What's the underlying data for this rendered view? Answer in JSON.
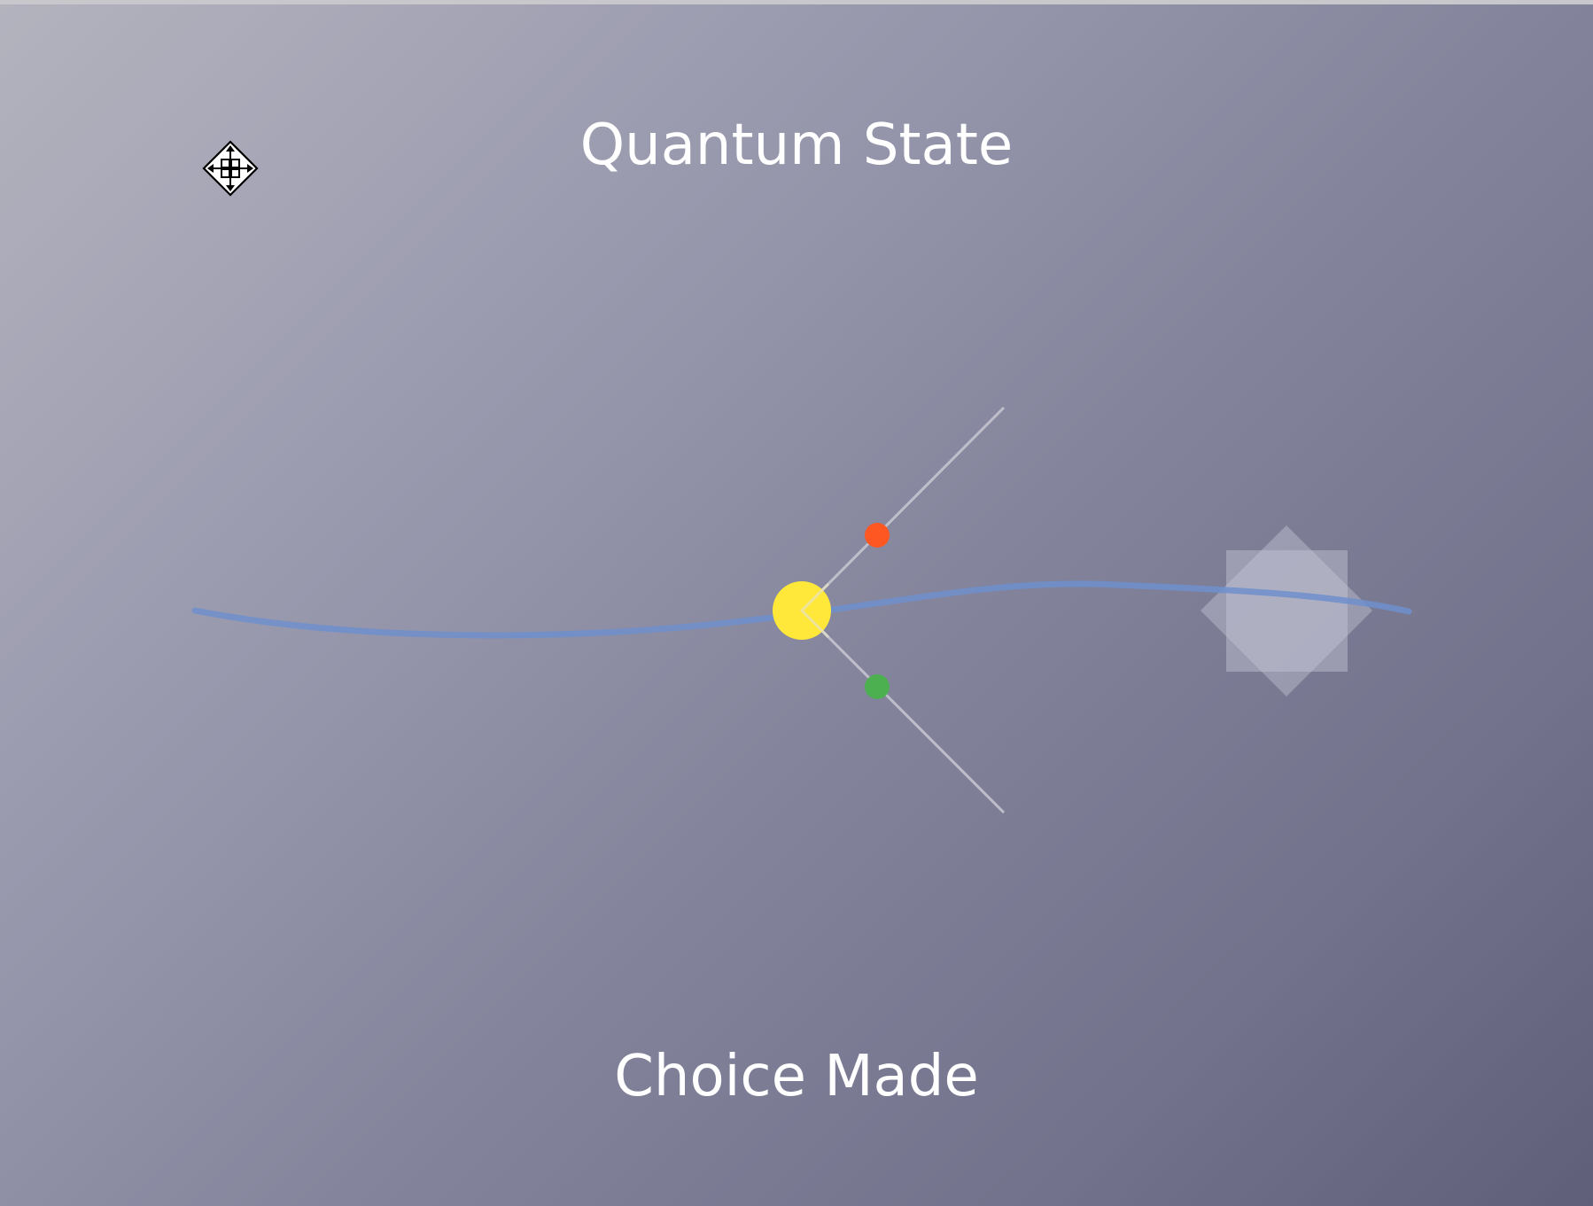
{
  "title": "Quantum State",
  "caption": "Choice Made",
  "icons": {
    "cursor": "move-cursor-icon"
  },
  "colors": {
    "wave": "#6e8fcc",
    "center_node": "#ffe83a",
    "upper_node": "#ff5722",
    "lower_node": "#4caf50",
    "branch_lines": "#c9c9d3",
    "diamond_shape": "#c7c7d8"
  }
}
